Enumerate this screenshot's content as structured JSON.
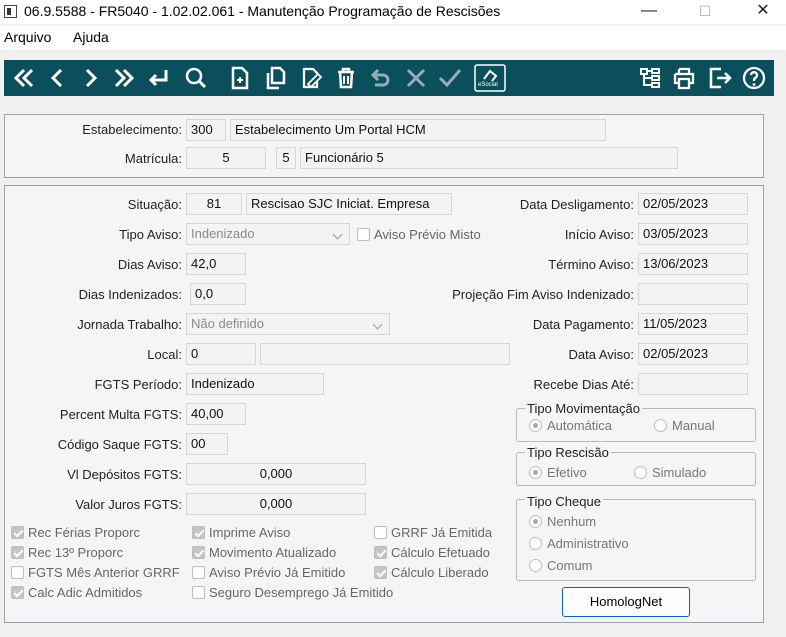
{
  "window": {
    "title": "06.9.5588 - FR5040 - 1.02.02.061 - Manutenção Programação de Rescisões",
    "minimize": "—",
    "maximize": "☐",
    "close": "✕"
  },
  "menu": {
    "items": [
      "Arquivo",
      "Ajuda"
    ]
  },
  "toolbar": {
    "colors": {
      "background": "#0b4f5c",
      "icon": "#ffffff",
      "disabled_icon": "#8fb0b6"
    },
    "esocial_label": "eSocial",
    "icons": [
      "first-icon",
      "previous-icon",
      "next-icon",
      "last-icon",
      "enter-icon",
      "search-icon",
      "new-icon",
      "copy-icon",
      "edit-icon",
      "delete-icon",
      "undo-icon",
      "cancel-icon",
      "confirm-icon",
      "esocial-icon",
      "tree-icon",
      "print-icon",
      "exit-icon",
      "help-icon"
    ]
  },
  "header": {
    "estabelecimento_label": "Estabelecimento:",
    "estabelecimento_code": "300",
    "estabelecimento_name": "Estabelecimento Um Portal HCM",
    "matricula_label": "Matrícula:",
    "matricula_code": "5",
    "matricula_digit": "5",
    "matricula_name": "Funcionário 5"
  },
  "form": {
    "situacao_label": "Situação:",
    "situacao_code": "81",
    "situacao_desc": "Rescisao SJC Iniciat. Empresa",
    "tipo_aviso_label": "Tipo Aviso:",
    "tipo_aviso_value": "Indenizado",
    "aviso_previo_misto_label": "Aviso Prévio Misto",
    "dias_aviso_label": "Dias Aviso:",
    "dias_aviso_value": "42,0",
    "dias_indenizados_label": "Dias Indenizados:",
    "dias_indenizados_value": "0,0",
    "jornada_label": "Jornada Trabalho:",
    "jornada_value": "Não definido",
    "local_label": "Local:",
    "local_code": "0",
    "local_desc": "",
    "fgts_periodo_label": "FGTS Período:",
    "fgts_periodo_value": "Indenizado",
    "percent_multa_label": "Percent Multa FGTS:",
    "percent_multa_value": "40,00",
    "codigo_saque_label": "Código Saque FGTS:",
    "codigo_saque_value": "00",
    "vl_depositos_label": "Vl Depósitos FGTS:",
    "vl_depositos_value": "0,000",
    "valor_juros_label": "Valor Juros FGTS:",
    "valor_juros_value": "0,000",
    "data_desligamento_label": "Data Desligamento:",
    "data_desligamento_value": "02/05/2023",
    "inicio_aviso_label": "Início Aviso:",
    "inicio_aviso_value": "03/05/2023",
    "termino_aviso_label": "Término Aviso:",
    "termino_aviso_value": "13/06/2023",
    "projecao_label": "Projeção Fim Aviso Indenizado:",
    "projecao_value": "",
    "data_pagamento_label": "Data Pagamento:",
    "data_pagamento_value": "11/05/2023",
    "data_aviso_label": "Data Aviso:",
    "data_aviso_value": "02/05/2023",
    "recebe_dias_label": "Recebe Dias Até:",
    "recebe_dias_value": ""
  },
  "tipo_movimentacao": {
    "title": "Tipo Movimentação",
    "options": [
      "Automática",
      "Manual"
    ],
    "selected": "Automática"
  },
  "tipo_rescisao": {
    "title": "Tipo Rescisão",
    "options": [
      "Efetivo",
      "Simulado"
    ],
    "selected": "Efetivo"
  },
  "tipo_cheque": {
    "title": "Tipo Cheque",
    "options": [
      "Nenhum",
      "Administrativo",
      "Comum"
    ],
    "selected": "Nenhum"
  },
  "checkboxes": {
    "rec_ferias": {
      "label": "Rec Férias Proporc",
      "checked": true
    },
    "rec_13": {
      "label": "Rec 13º Proporc",
      "checked": true
    },
    "fgts_mes_anterior": {
      "label": "FGTS Mês Anterior GRRF",
      "checked": false
    },
    "calc_adic": {
      "label": "Calc Adic Admitidos",
      "checked": true
    },
    "imprime_aviso": {
      "label": "Imprime Aviso",
      "checked": true
    },
    "movimento_atualizado": {
      "label": "Movimento Atualizado",
      "checked": true
    },
    "aviso_previo_emitido": {
      "label": "Aviso Prévio Já Emitido",
      "checked": false
    },
    "seguro_desemprego": {
      "label": "Seguro Desemprego Já Emitido",
      "checked": false
    },
    "grrf_emitida": {
      "label": "GRRF Já Emitida",
      "checked": false
    },
    "calculo_efetuado": {
      "label": "Cálculo Efetuado",
      "checked": true
    },
    "calculo_liberado": {
      "label": "Cálculo Liberado",
      "checked": true
    }
  },
  "homolognet_button": "HomologNet"
}
